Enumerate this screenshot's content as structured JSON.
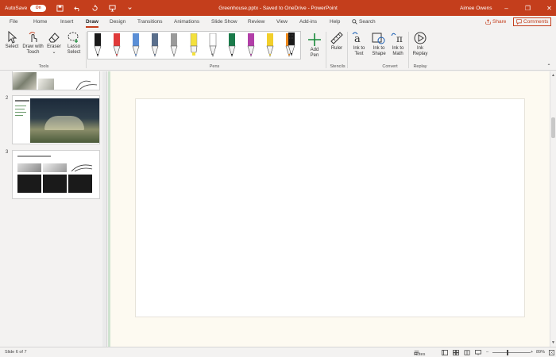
{
  "titlebar": {
    "autosave_label": "AutoSave",
    "autosave_state": "On",
    "doc_title": "Greenhouse.pptx - Saved to OneDrive - PowerPoint",
    "user_name": "Aimee Owens"
  },
  "tabs": [
    {
      "label": "File"
    },
    {
      "label": "Home"
    },
    {
      "label": "Insert"
    },
    {
      "label": "Draw"
    },
    {
      "label": "Design"
    },
    {
      "label": "Transitions"
    },
    {
      "label": "Animations"
    },
    {
      "label": "Slide Show"
    },
    {
      "label": "Review"
    },
    {
      "label": "View"
    },
    {
      "label": "Add-ins"
    },
    {
      "label": "Help"
    }
  ],
  "search_label": "Search",
  "share_label": "Share",
  "comments_label": "Comments",
  "ribbon": {
    "select": "Select",
    "draw_with_touch_1": "Draw with",
    "draw_with_touch_2": "Touch",
    "eraser": "Eraser",
    "lasso_1": "Lasso",
    "lasso_2": "Select",
    "add_pen_1": "Add",
    "add_pen_2": "Pen",
    "ruler": "Ruler",
    "ink_to_text_1": "Ink to",
    "ink_to_text_2": "Text",
    "ink_to_shape_1": "Ink to",
    "ink_to_shape_2": "Shape",
    "ink_to_math_1": "Ink to",
    "ink_to_math_2": "Math",
    "ink_replay_1": "Ink",
    "ink_replay_2": "Replay",
    "groups": {
      "tools": "Tools",
      "pens": "Pens",
      "stencils": "Stencils",
      "convert": "Convert",
      "replay": "Replay"
    },
    "pen_colors": [
      "#1a1a1a",
      "#e03a3a",
      "#5b8fd6",
      "#5a6f8c",
      "#9a9a9a",
      "#f4e13c",
      "#ffffff",
      "#1a7a4a",
      "#b23fa8",
      "#f2cf2b",
      "#f08a1c",
      "#1a1a1a"
    ]
  },
  "slides": [
    {
      "number": "2"
    },
    {
      "number": "3"
    }
  ],
  "status": {
    "slide_info": "Slide 6 of 7",
    "notes": "Notes",
    "zoom": "89%"
  },
  "colors": {
    "accent": "#c43e1c",
    "canvas_bg": "#fdfaf1"
  }
}
